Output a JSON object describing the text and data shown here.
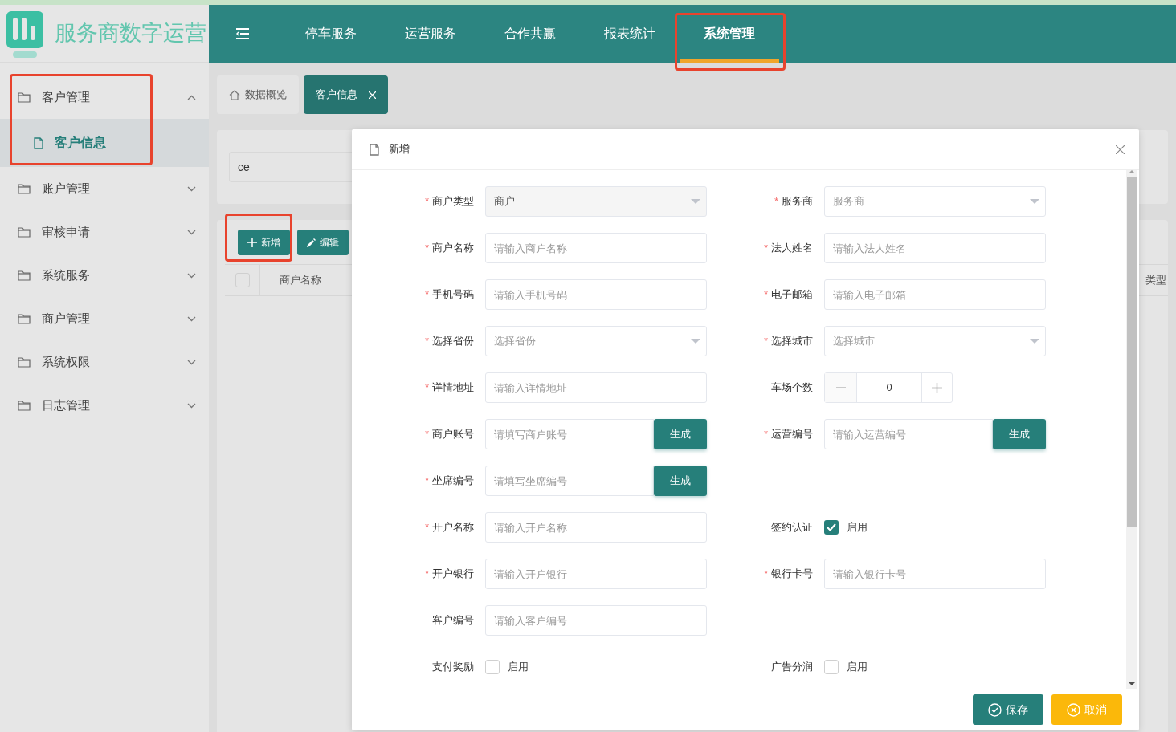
{
  "logo": {
    "title": "服务商数字运营"
  },
  "nav": [
    {
      "label": "停车服务",
      "selected": false,
      "highlighted": false
    },
    {
      "label": "运营服务",
      "selected": false,
      "highlighted": false
    },
    {
      "label": "合作共赢",
      "selected": false,
      "highlighted": false
    },
    {
      "label": "报表统计",
      "selected": false,
      "highlighted": false
    },
    {
      "label": "系统管理",
      "selected": true,
      "highlighted": true
    }
  ],
  "sidebar": {
    "groups": [
      {
        "label": "客户管理",
        "expanded": true,
        "highlighted": true,
        "children": [
          {
            "label": "客户信息",
            "selected": true
          }
        ]
      },
      {
        "label": "账户管理",
        "expanded": false,
        "highlighted": false
      },
      {
        "label": "审核申请",
        "expanded": false,
        "highlighted": false
      },
      {
        "label": "系统服务",
        "expanded": false,
        "highlighted": false
      },
      {
        "label": "商户管理",
        "expanded": false,
        "highlighted": false
      },
      {
        "label": "系统权限",
        "expanded": false,
        "highlighted": false
      },
      {
        "label": "日志管理",
        "expanded": false,
        "highlighted": false
      }
    ]
  },
  "tabs": [
    {
      "label": "数据概览",
      "kind": "home",
      "selected": false
    },
    {
      "label": "客户信息",
      "kind": "closable",
      "selected": true
    }
  ],
  "search": {
    "value": "ce"
  },
  "toolbar": [
    {
      "label": "新增",
      "kind": "add",
      "highlighted": true
    },
    {
      "label": "编辑",
      "kind": "edit",
      "highlighted": false
    }
  ],
  "table": {
    "select_all": false,
    "columns": [
      "商户名称",
      "类型"
    ]
  },
  "dialog": {
    "title": "新增",
    "rows": [
      {
        "left": {
          "kind": "select",
          "asterisk": "*",
          "label": "商户类型",
          "value": "商户",
          "disabled": true
        },
        "right": {
          "kind": "select",
          "asterisk": "*",
          "label": "服务商",
          "placeholder": "服务商",
          "disabled": false
        }
      },
      {
        "left": {
          "kind": "input",
          "asterisk": "*",
          "label": "商户名称",
          "placeholder": "请输入商户名称"
        },
        "right": {
          "kind": "input",
          "asterisk": "*",
          "label": "法人姓名",
          "placeholder": "请输入法人姓名"
        }
      },
      {
        "left": {
          "kind": "input",
          "asterisk": "*",
          "label": "手机号码",
          "placeholder": "请输入手机号码"
        },
        "right": {
          "kind": "input",
          "asterisk": "*",
          "label": "电子邮箱",
          "placeholder": "请输入电子邮箱"
        }
      },
      {
        "left": {
          "kind": "select",
          "asterisk": "*",
          "label": "选择省份",
          "placeholder": "选择省份",
          "disabled": false
        },
        "right": {
          "kind": "select",
          "asterisk": "*",
          "label": "选择城市",
          "placeholder": "选择城市",
          "disabled": false
        }
      },
      {
        "left": {
          "kind": "input",
          "asterisk": "*",
          "label": "详情地址",
          "placeholder": "请输入详情地址"
        },
        "right": {
          "kind": "number",
          "label": "车场个数",
          "value": "0"
        }
      },
      {
        "left": {
          "kind": "generate",
          "asterisk": "*",
          "label": "商户账号",
          "placeholder": "请填写商户账号",
          "button": "生成"
        },
        "right": {
          "kind": "generate",
          "asterisk": "*",
          "label": "运营编号",
          "placeholder": "请输入运营编号",
          "button": "生成"
        }
      },
      {
        "left": {
          "kind": "generate",
          "asterisk": "*",
          "label": "坐席编号",
          "placeholder": "请填写坐席编号",
          "button": "生成"
        }
      },
      {
        "left": {
          "kind": "input",
          "asterisk": "*",
          "label": "开户名称",
          "placeholder": "请输入开户名称"
        },
        "right": {
          "kind": "checkbox",
          "label": "签约认证",
          "text": "启用",
          "checked": true
        }
      },
      {
        "left": {
          "kind": "input",
          "asterisk": "*",
          "label": "开户银行",
          "placeholder": "请输入开户银行"
        },
        "right": {
          "kind": "input",
          "asterisk": "*",
          "label": "银行卡号",
          "placeholder": "请输入银行卡号"
        }
      },
      {
        "left": {
          "kind": "input",
          "label": "客户编号",
          "placeholder": "请输入客户编号"
        }
      },
      {
        "left": {
          "kind": "checkbox",
          "label": "支付奖励",
          "text": "启用",
          "checked": false
        },
        "right": {
          "kind": "checkbox",
          "label": "广告分润",
          "text": "启用",
          "checked": false
        }
      }
    ],
    "buttons": [
      {
        "label": "保存",
        "kind": "save"
      },
      {
        "label": "取消",
        "kind": "cancel"
      }
    ]
  }
}
